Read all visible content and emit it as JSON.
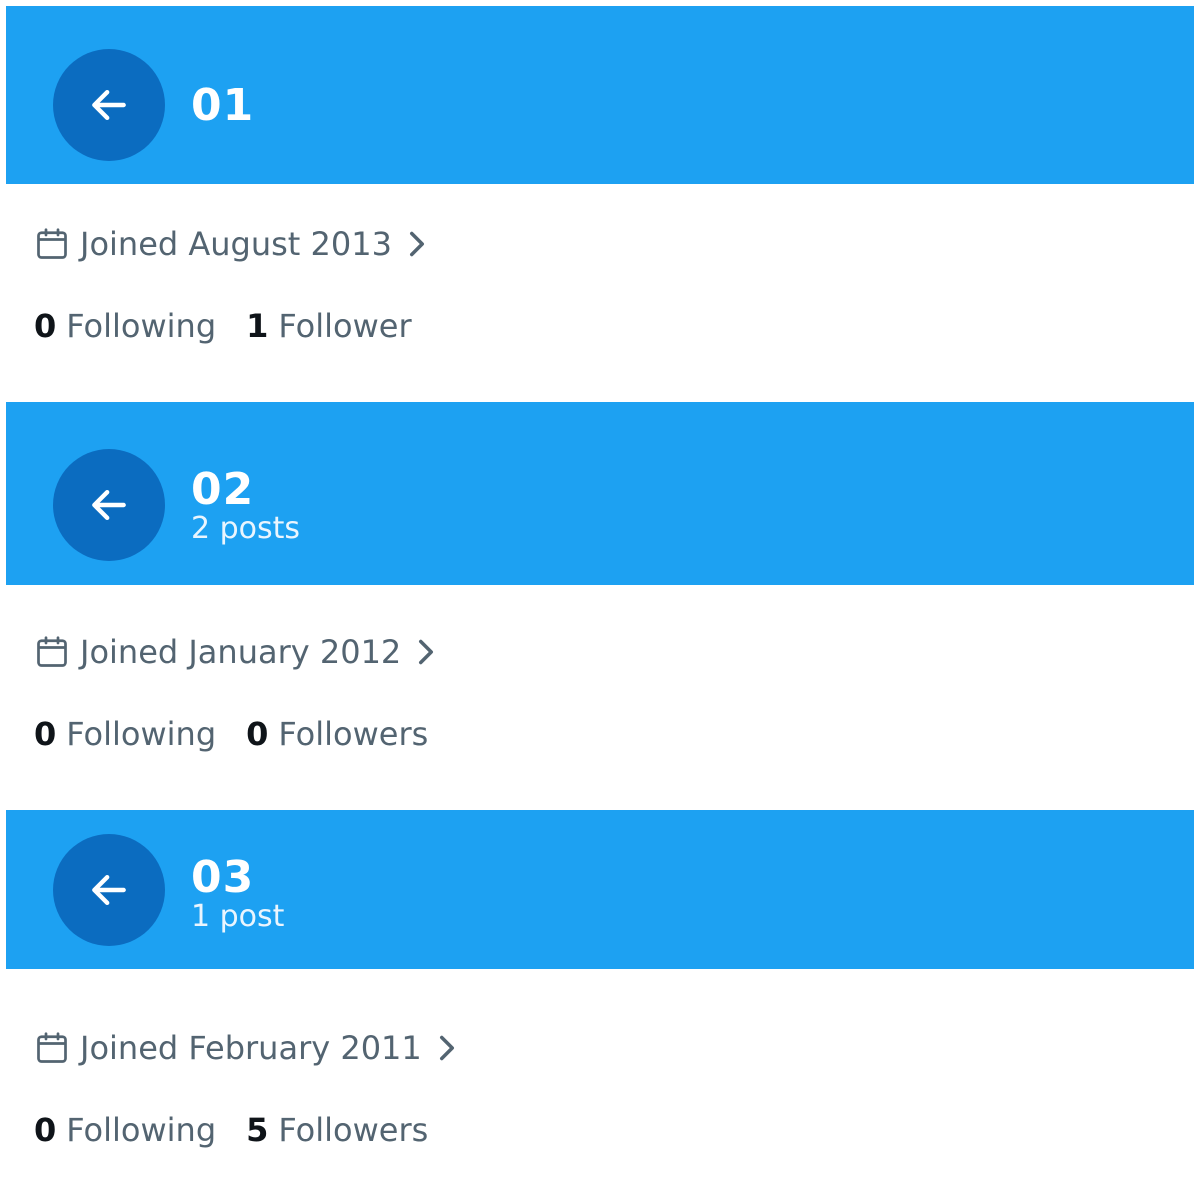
{
  "profiles": [
    {
      "name": "01",
      "posts": "",
      "joined": "Joined August 2013",
      "following_count": "0",
      "following_label": "Following",
      "followers_count": "1",
      "followers_label": "Follower"
    },
    {
      "name": "02",
      "posts": "2 posts",
      "joined": "Joined January 2012",
      "following_count": "0",
      "following_label": "Following",
      "followers_count": "0",
      "followers_label": "Followers"
    },
    {
      "name": "03",
      "posts": "1 post",
      "joined": "Joined February 2011",
      "following_count": "0",
      "following_label": "Following",
      "followers_count": "5",
      "followers_label": "Followers"
    }
  ],
  "icons": {
    "back": "arrow-left-icon",
    "calendar": "calendar-icon",
    "chevron": "chevron-right-icon"
  },
  "colors": {
    "header_blue": "#1da1f2",
    "button_blue": "#0b6cc0",
    "secondary_text": "#536471",
    "primary_text": "#0f1419"
  }
}
